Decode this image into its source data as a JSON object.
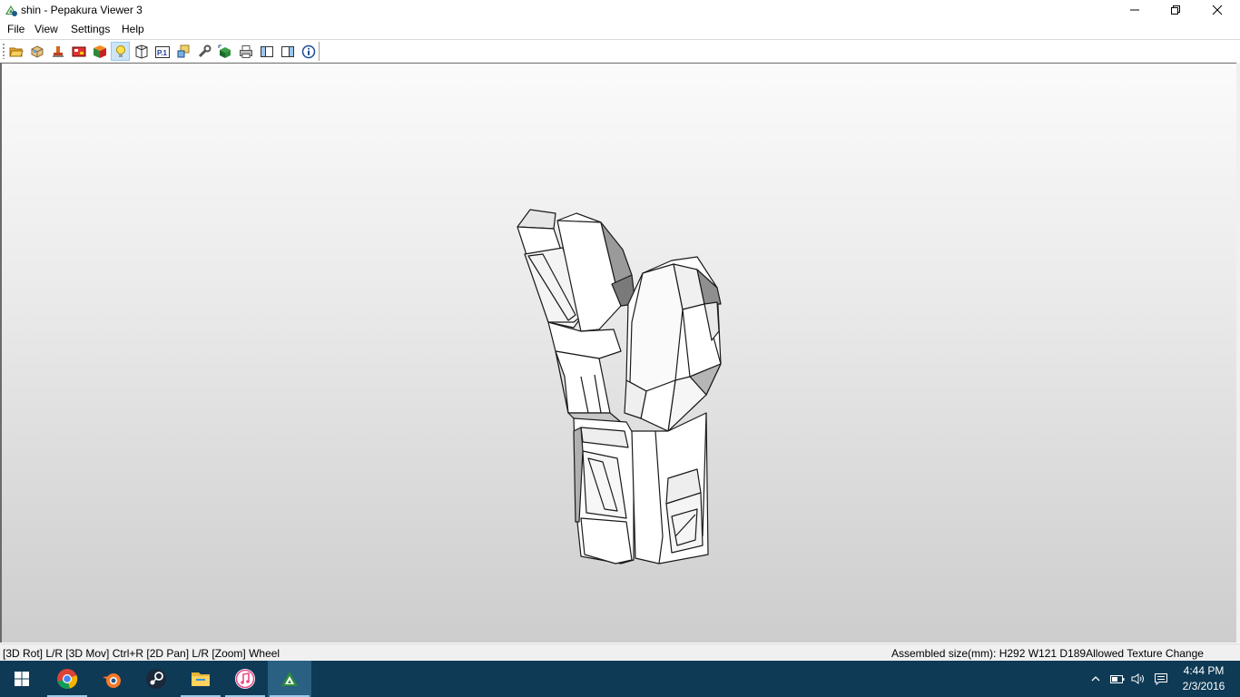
{
  "window": {
    "title": "shin - Pepakura Viewer 3",
    "controls": [
      "minimize-icon",
      "maximize-icon",
      "close-icon"
    ]
  },
  "menu": {
    "items": [
      "File",
      "View",
      "Settings",
      "Help"
    ]
  },
  "toolbar": {
    "buttons": [
      {
        "icon": "open-folder-icon",
        "active": false
      },
      {
        "icon": "3d-part-icon",
        "active": false
      },
      {
        "icon": "pen-stamp-icon",
        "active": false
      },
      {
        "icon": "texture-icon",
        "active": false
      },
      {
        "icon": "colored-cube-icon",
        "active": false
      },
      {
        "icon": "lightbulb-icon",
        "active": true
      },
      {
        "icon": "wireframe-icon",
        "active": false
      },
      {
        "icon": "page-number-icon",
        "active": false,
        "label": "P.1"
      },
      {
        "icon": "parts-layout-icon",
        "active": false
      },
      {
        "icon": "wrench-icon",
        "active": false
      },
      {
        "icon": "select-cube-icon",
        "active": false
      },
      {
        "icon": "printer-icon",
        "active": false
      },
      {
        "icon": "single-pane-icon",
        "active": false
      },
      {
        "icon": "split-pane-icon",
        "active": false
      },
      {
        "icon": "info-icon",
        "active": false
      }
    ]
  },
  "status": {
    "controls_hint": "[3D Rot] L/R [3D Mov] Ctrl+R [2D Pan] L/R [Zoom] Wheel",
    "assembled_size": "Assembled size(mm): H292 W121 D189",
    "texture_mode": "Allowed Texture Change"
  },
  "taskbar": {
    "apps": [
      {
        "icon": "windows-start-icon",
        "open": false,
        "active": false
      },
      {
        "icon": "chrome-icon",
        "open": true,
        "active": false
      },
      {
        "icon": "blender-icon",
        "open": false,
        "active": false
      },
      {
        "icon": "steam-icon",
        "open": false,
        "active": false
      },
      {
        "icon": "file-explorer-icon",
        "open": true,
        "active": false
      },
      {
        "icon": "itunes-icon",
        "open": true,
        "active": false
      },
      {
        "icon": "pepakura-icon",
        "open": true,
        "active": true
      }
    ],
    "tray_icons": [
      "chevron-up-icon",
      "battery-icon",
      "volume-icon",
      "notifications-icon"
    ],
    "clock_time": "4:44 PM",
    "clock_date": "2/3/2016"
  },
  "colors": {
    "taskbar_bg": "#0e3a55",
    "toolbar_active_bg": "#cce4f7",
    "viewport_top": "#fbfbfb",
    "viewport_bottom": "#cdcdcd"
  }
}
